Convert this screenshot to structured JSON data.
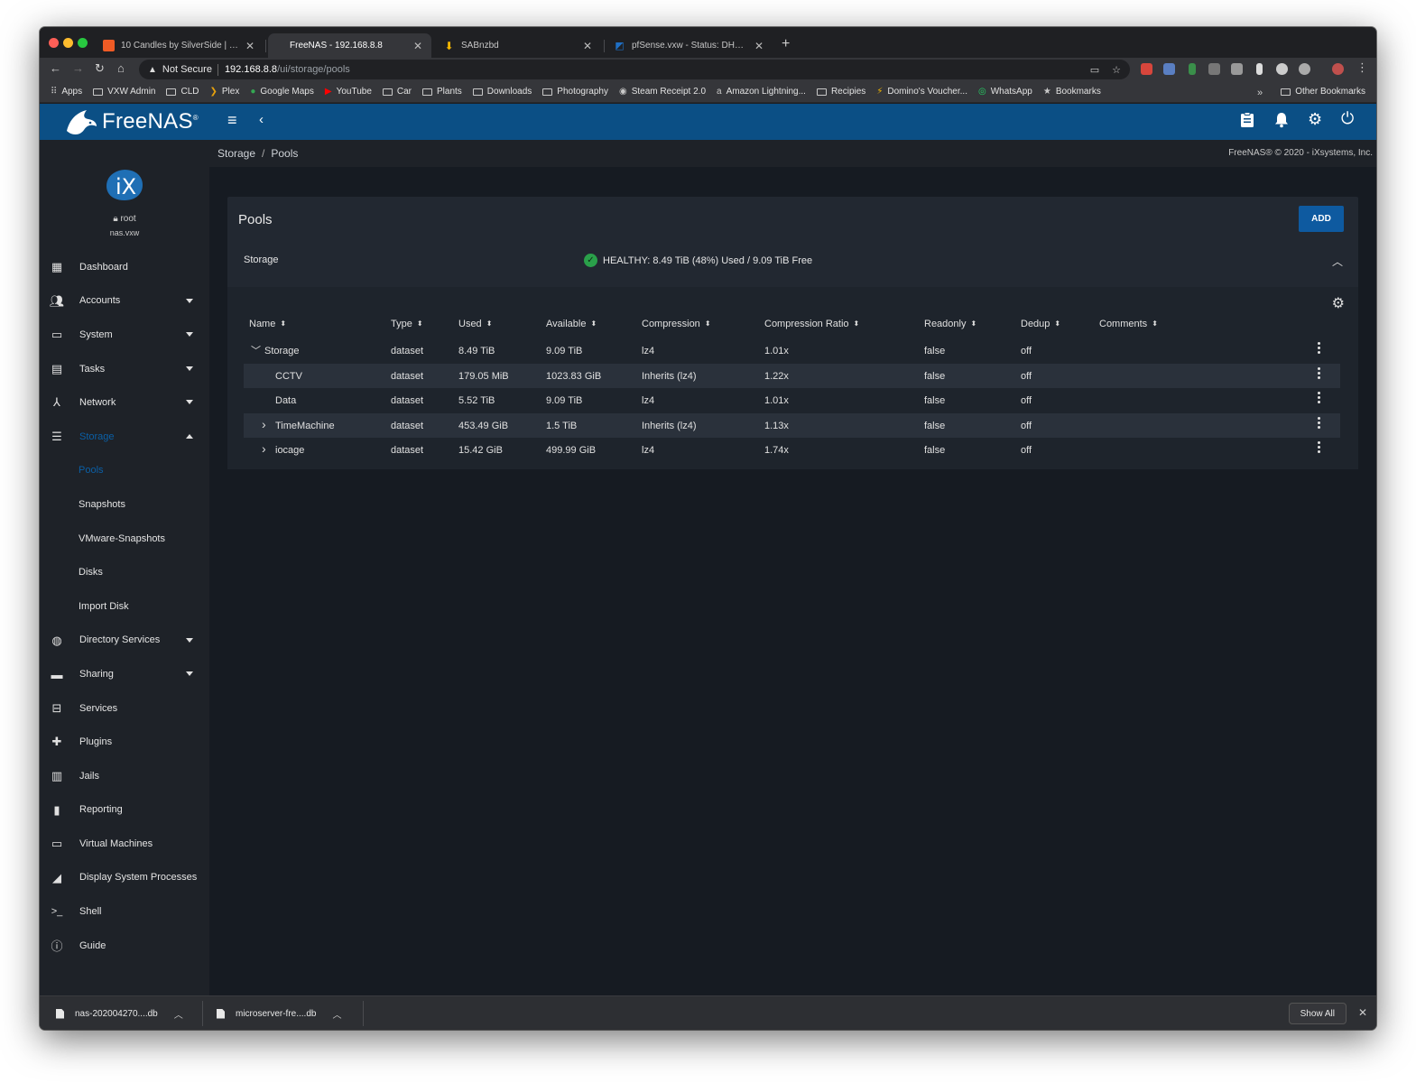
{
  "browser": {
    "tabs": [
      {
        "title": "10 Candles by SilverSide | Silve",
        "favicon_color": "#ef5b25"
      },
      {
        "title": "FreeNAS - 192.168.8.8",
        "favicon_color": "#35363a",
        "active": true
      },
      {
        "title": "SABnzbd",
        "favicon_color": "#f5b700"
      },
      {
        "title": "pfSense.vxw - Status: DHCP Le",
        "favicon_color": "#1f6fc4"
      }
    ],
    "address": {
      "security_label": "Not Secure",
      "host": "192.168.8.8",
      "path": "/ui/storage/pools"
    },
    "bookmarks": [
      {
        "label": "Apps",
        "icon": "apps-grid-icon"
      },
      {
        "label": "VXW Admin",
        "icon": "folder-icon"
      },
      {
        "label": "CLD",
        "icon": "folder-icon"
      },
      {
        "label": "Plex",
        "icon": "plex-icon"
      },
      {
        "label": "Google Maps",
        "icon": "maps-pin-icon"
      },
      {
        "label": "YouTube",
        "icon": "youtube-icon"
      },
      {
        "label": "Car",
        "icon": "folder-icon"
      },
      {
        "label": "Plants",
        "icon": "folder-icon"
      },
      {
        "label": "Downloads",
        "icon": "folder-icon"
      },
      {
        "label": "Photography",
        "icon": "folder-icon"
      },
      {
        "label": "Steam Receipt 2.0",
        "icon": "steam-icon"
      },
      {
        "label": "Amazon Lightning...",
        "icon": "amazon-icon"
      },
      {
        "label": "Recipies",
        "icon": "folder-icon"
      },
      {
        "label": "Domino's Voucher...",
        "icon": "bolt-icon"
      },
      {
        "label": "WhatsApp",
        "icon": "whatsapp-icon"
      },
      {
        "label": "Bookmarks",
        "icon": "star-icon"
      }
    ],
    "bookmarks_overflow": "»",
    "other_bookmarks": "Other Bookmarks"
  },
  "app": {
    "logo_text": "FreeNAS",
    "logo_mark": "®",
    "brand_color": "#0b4f85",
    "accent_color": "#0b5fa5"
  },
  "user": {
    "name": "root",
    "host": "nas.vxw"
  },
  "sidebar": {
    "items": [
      {
        "label": "Dashboard",
        "icon": "dashboard-icon"
      },
      {
        "label": "Accounts",
        "icon": "people-icon",
        "caret": "down"
      },
      {
        "label": "System",
        "icon": "laptop-icon",
        "caret": "down"
      },
      {
        "label": "Tasks",
        "icon": "calendar-icon",
        "caret": "down"
      },
      {
        "label": "Network",
        "icon": "network-icon",
        "caret": "down"
      },
      {
        "label": "Storage",
        "icon": "storage-icon",
        "caret": "up",
        "active": true
      },
      {
        "label": "Pools",
        "sub": true,
        "active": true
      },
      {
        "label": "Snapshots",
        "sub": true
      },
      {
        "label": "VMware-Snapshots",
        "sub": true
      },
      {
        "label": "Disks",
        "sub": true
      },
      {
        "label": "Import Disk",
        "sub": true
      },
      {
        "label": "Directory Services",
        "icon": "directory-icon",
        "caret": "down"
      },
      {
        "label": "Sharing",
        "icon": "folder-shared-icon",
        "caret": "down"
      },
      {
        "label": "Services",
        "icon": "tune-icon"
      },
      {
        "label": "Plugins",
        "icon": "puzzle-icon"
      },
      {
        "label": "Jails",
        "icon": "jail-icon"
      },
      {
        "label": "Reporting",
        "icon": "chart-icon"
      },
      {
        "label": "Virtual Machines",
        "icon": "computer-icon"
      },
      {
        "label": "Display System Processes",
        "icon": "processes-icon"
      },
      {
        "label": "Shell",
        "icon": "terminal-icon"
      },
      {
        "label": "Guide",
        "icon": "info-icon"
      }
    ]
  },
  "breadcrumb": {
    "parent": "Storage",
    "sep": "/",
    "current": "Pools"
  },
  "copyright": "FreeNAS® © 2020 - iXsystems, Inc.",
  "pools": {
    "title": "Pools",
    "add_label": "ADD",
    "pool_name": "Storage",
    "status": "HEALTHY: 8.49 TiB (48%) Used / 9.09 TiB Free",
    "status_color": "#2aa04a",
    "columns": [
      "Name",
      "Type",
      "Used",
      "Available",
      "Compression",
      "Compression Ratio",
      "Readonly",
      "Dedup",
      "Comments"
    ],
    "rows": [
      {
        "name": "Storage",
        "type": "dataset",
        "used": "8.49 TiB",
        "available": "9.09 TiB",
        "compression": "lz4",
        "ratio": "1.01x",
        "readonly": "false",
        "dedup": "off",
        "comments": "",
        "level": 0,
        "expander": "expanded"
      },
      {
        "name": "CCTV",
        "type": "dataset",
        "used": "179.05 MiB",
        "available": "1023.83 GiB",
        "compression": "Inherits (lz4)",
        "ratio": "1.22x",
        "readonly": "false",
        "dedup": "off",
        "comments": "",
        "level": 1,
        "expander": "none"
      },
      {
        "name": "Data",
        "type": "dataset",
        "used": "5.52 TiB",
        "available": "9.09 TiB",
        "compression": "lz4",
        "ratio": "1.01x",
        "readonly": "false",
        "dedup": "off",
        "comments": "",
        "level": 1,
        "expander": "none"
      },
      {
        "name": "TimeMachine",
        "type": "dataset",
        "used": "453.49 GiB",
        "available": "1.5 TiB",
        "compression": "Inherits (lz4)",
        "ratio": "1.13x",
        "readonly": "false",
        "dedup": "off",
        "comments": "",
        "level": 1,
        "expander": "collapsed"
      },
      {
        "name": "iocage",
        "type": "dataset",
        "used": "15.42 GiB",
        "available": "499.99 GiB",
        "compression": "lz4",
        "ratio": "1.74x",
        "readonly": "false",
        "dedup": "off",
        "comments": "",
        "level": 1,
        "expander": "collapsed"
      }
    ]
  },
  "downloads": {
    "items": [
      {
        "name": "nas-202004270....db"
      },
      {
        "name": "microserver-fre....db"
      }
    ],
    "show_all": "Show All"
  }
}
